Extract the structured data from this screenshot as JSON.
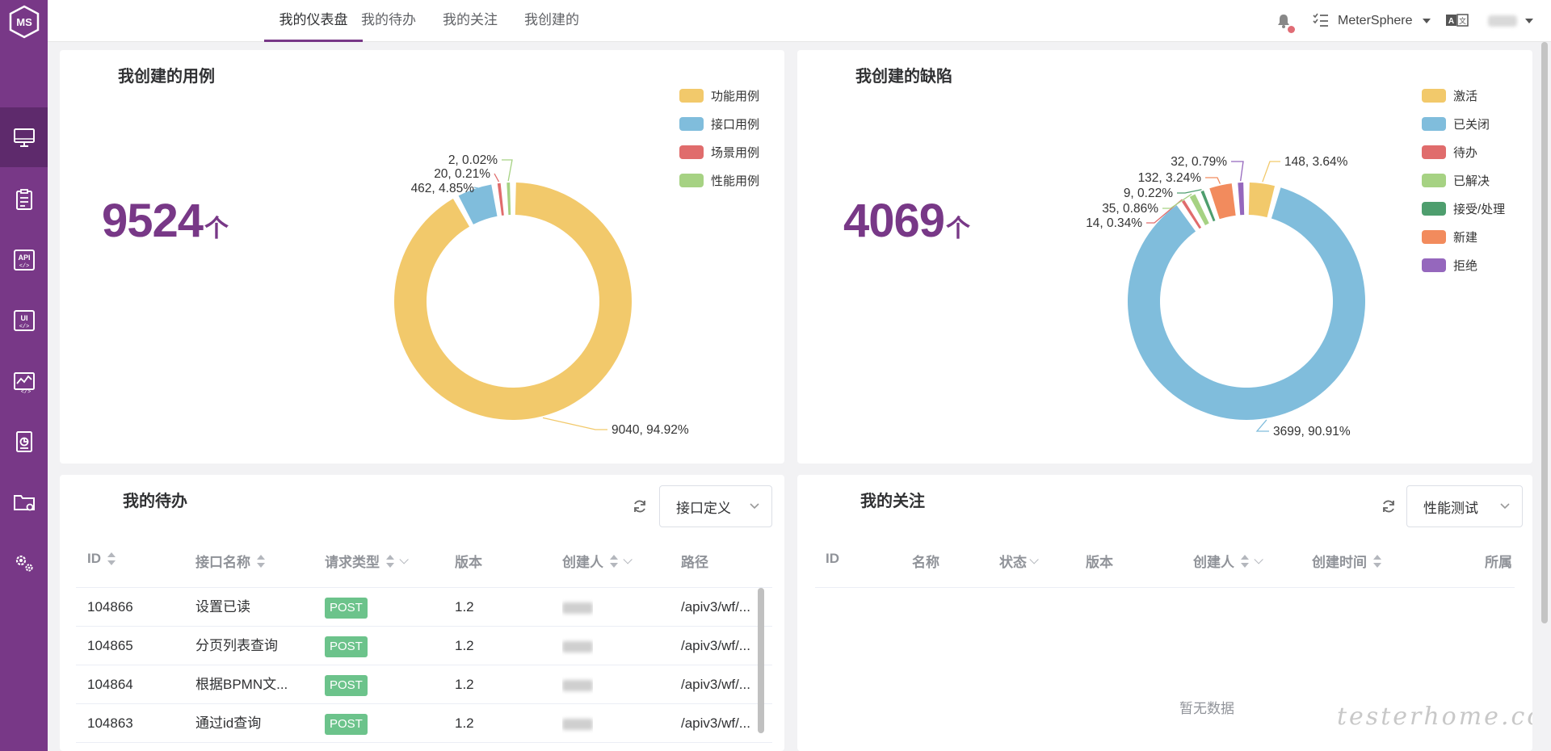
{
  "brand": {
    "logo_text": "MS",
    "accent": "#783887"
  },
  "sidebar": {
    "items": [
      {
        "icon": "monitor-icon",
        "active": true
      },
      {
        "icon": "clipboard-icon",
        "active": false
      },
      {
        "icon": "api-icon",
        "label": "API",
        "active": false
      },
      {
        "icon": "ui-icon",
        "label": "UI",
        "active": false
      },
      {
        "icon": "performance-chart-icon",
        "active": false
      },
      {
        "icon": "report-icon",
        "active": false
      },
      {
        "icon": "project-folder-icon",
        "active": false
      },
      {
        "icon": "settings-icon",
        "active": false
      }
    ]
  },
  "header": {
    "tabs": [
      {
        "label": "我的仪表盘",
        "active": true
      },
      {
        "label": "我的待办",
        "active": false
      },
      {
        "label": "我的关注",
        "active": false
      },
      {
        "label": "我创建的",
        "active": false
      }
    ],
    "workspace": "MeterSphere",
    "notification_icon": "bell-icon",
    "task_icon": "task-list-icon",
    "language_icon": "language-icon"
  },
  "cases_card": {
    "title": "我创建的用例",
    "total": "9524",
    "unit": "个",
    "legend": [
      {
        "label": "功能用例",
        "color": "#f2c96b"
      },
      {
        "label": "接口用例",
        "color": "#80bddc"
      },
      {
        "label": "场景用例",
        "color": "#e06c6c"
      },
      {
        "label": "性能用例",
        "color": "#a6d283"
      }
    ],
    "chart_data": {
      "type": "pie",
      "categories": [
        "功能用例",
        "接口用例",
        "场景用例",
        "性能用例"
      ],
      "values": [
        9040,
        462,
        20,
        2
      ],
      "data_labels": [
        "9040, 94.92%",
        "462, 4.85%",
        "20, 0.21%",
        "2, 0.02%"
      ]
    }
  },
  "bugs_card": {
    "title": "我创建的缺陷",
    "total": "4069",
    "unit": "个",
    "legend": [
      {
        "label": "激活",
        "color": "#f2c96b"
      },
      {
        "label": "已关闭",
        "color": "#80bddc"
      },
      {
        "label": "待办",
        "color": "#e06c6c"
      },
      {
        "label": "已解决",
        "color": "#a6d283"
      },
      {
        "label": "接受/处理",
        "color": "#4e9e6e"
      },
      {
        "label": "新建",
        "color": "#f28b5d"
      },
      {
        "label": "拒绝",
        "color": "#9567bd"
      }
    ],
    "chart_data": {
      "type": "pie",
      "categories": [
        "激活",
        "已关闭",
        "待办",
        "已解决",
        "接受/处理",
        "新建",
        "拒绝"
      ],
      "values": [
        148,
        3699,
        14,
        35,
        9,
        132,
        32
      ],
      "data_labels": [
        "148, 3.64%",
        "3699, 90.91%",
        "14, 0.34%",
        "35, 0.86%",
        "9, 0.22%",
        "132, 3.24%",
        "32, 0.79%"
      ]
    }
  },
  "todo_card": {
    "title": "我的待办",
    "filter_value": "接口定义",
    "columns": [
      "ID",
      "接口名称",
      "请求类型",
      "版本",
      "创建人",
      "路径"
    ],
    "rows": [
      {
        "id": "104866",
        "name": "设置已读",
        "method": "POST",
        "version": "1.2",
        "path": "/apiv3/wf/..."
      },
      {
        "id": "104865",
        "name": "分页列表查询",
        "method": "POST",
        "version": "1.2",
        "path": "/apiv3/wf/..."
      },
      {
        "id": "104864",
        "name": "根据BPMN文...",
        "method": "POST",
        "version": "1.2",
        "path": "/apiv3/wf/..."
      },
      {
        "id": "104863",
        "name": "通过id查询",
        "method": "POST",
        "version": "1.2",
        "path": "/apiv3/wf/..."
      }
    ]
  },
  "follow_card": {
    "title": "我的关注",
    "filter_value": "性能测试",
    "columns": [
      "ID",
      "名称",
      "状态",
      "版本",
      "创建人",
      "创建时间",
      "所属"
    ],
    "empty_text": "暂无数据"
  },
  "watermark": "testerhome.com"
}
